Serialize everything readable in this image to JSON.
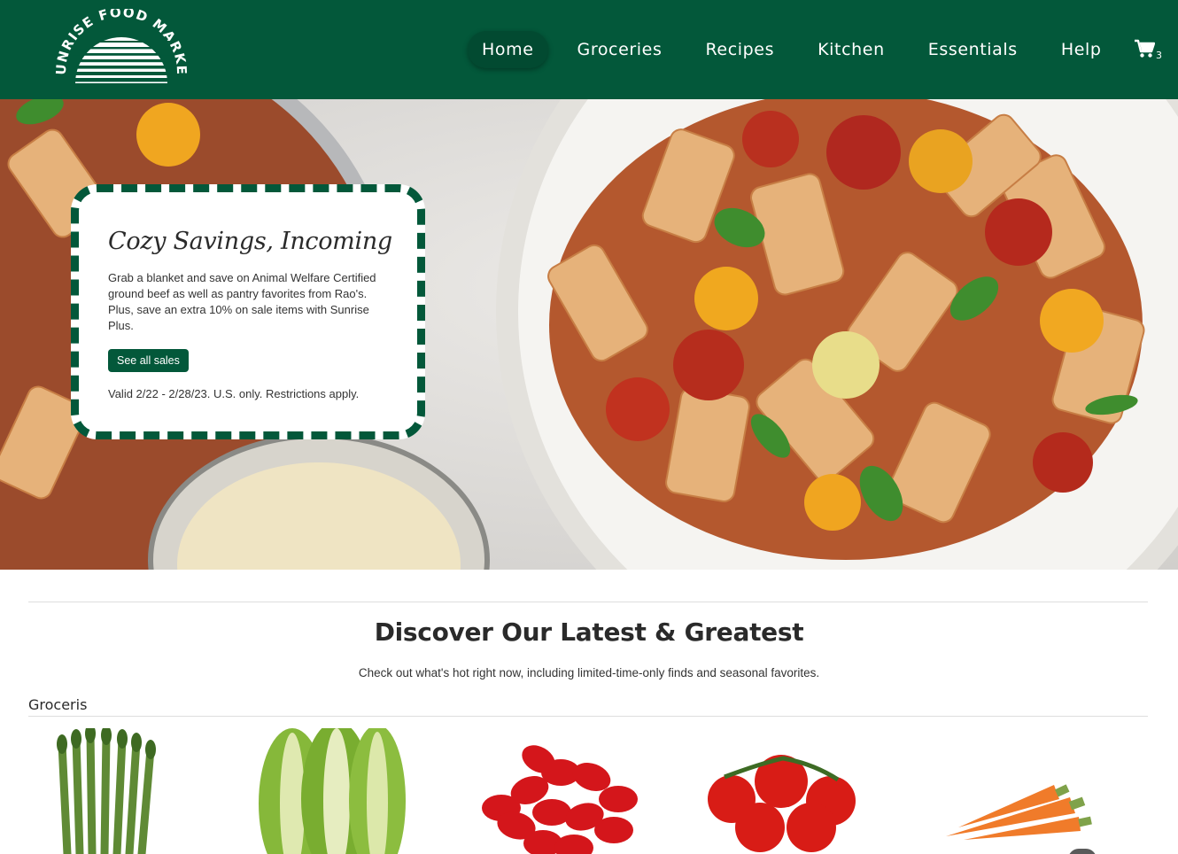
{
  "brand": {
    "logo_text": "SUNRISE FOOD MARKET"
  },
  "nav": {
    "items": [
      {
        "label": "Home",
        "active": true
      },
      {
        "label": "Groceries",
        "active": false
      },
      {
        "label": "Recipes",
        "active": false
      },
      {
        "label": "Kitchen",
        "active": false
      },
      {
        "label": "Essentials",
        "active": false
      },
      {
        "label": "Help",
        "active": false
      }
    ],
    "cart_icon": "cart-icon",
    "cart_count": "3"
  },
  "hero": {
    "title": "Cozy Savings, Incoming",
    "body": "Grab a blanket and save on Animal Welfare Certified ground beef as well as pantry favorites from Rao's. Plus, save an extra 10% on sale items with Sunrise Plus.",
    "button_label": "See all sales",
    "fine_print": "Valid 2/22 - 2/28/23. U.S. only. Restrictions apply."
  },
  "discover": {
    "title": "Discover Our Latest & Greatest",
    "subtitle": "Check out what's hot right now, including limited-time-only finds and seasonal favorites."
  },
  "groceries": {
    "label": "Groceris",
    "products": [
      {
        "icon": "asparagus-image"
      },
      {
        "icon": "romaine-lettuce-image"
      },
      {
        "icon": "grape-tomatoes-image"
      },
      {
        "icon": "vine-tomatoes-image"
      },
      {
        "icon": "carrots-image"
      }
    ]
  },
  "colors": {
    "brand_green": "#03583a",
    "white": "#ffffff"
  }
}
